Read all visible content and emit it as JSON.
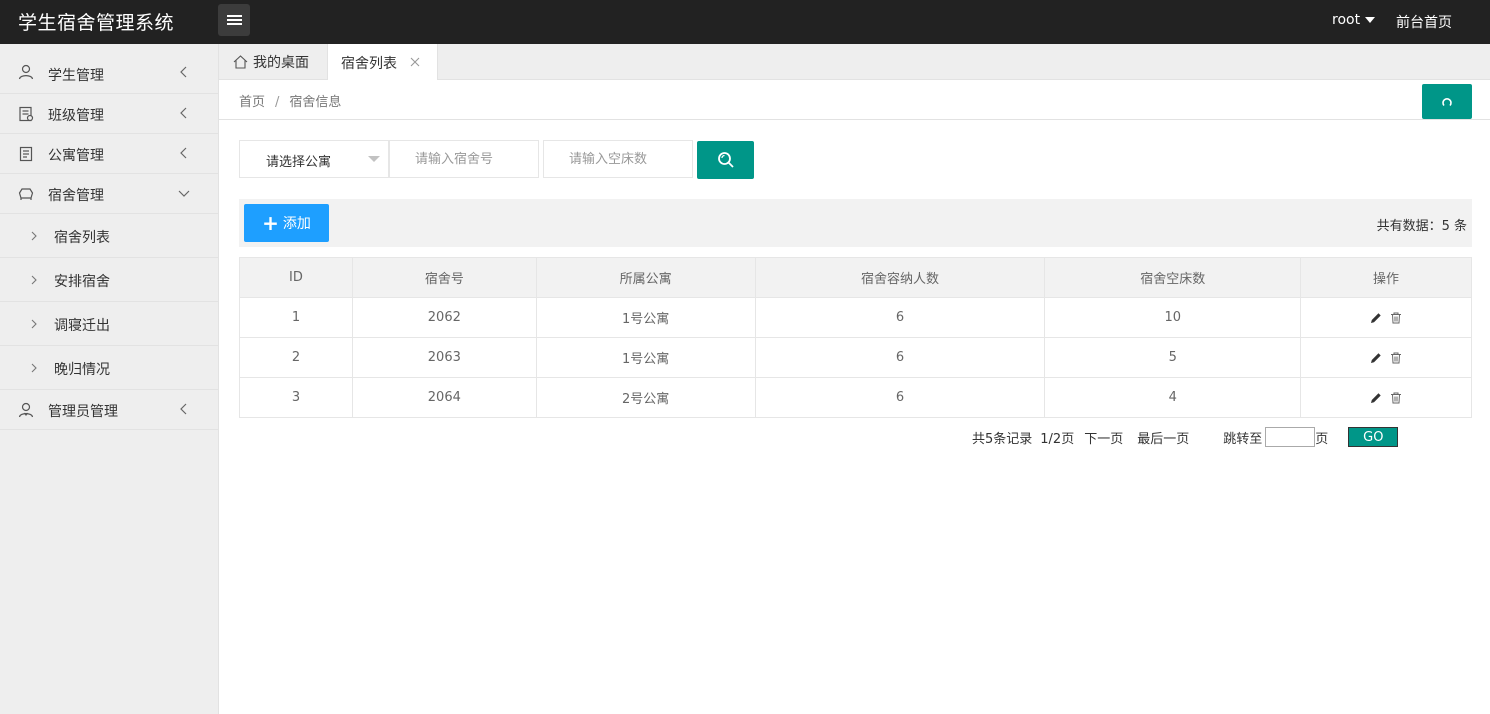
{
  "header": {
    "logo": "学生宿舍管理系统",
    "user": "root",
    "front_page": "前台首页"
  },
  "sidebar": {
    "items": [
      {
        "label": "学生管理",
        "icon": "user-icon"
      },
      {
        "label": "班级管理",
        "icon": "class-icon"
      },
      {
        "label": "公寓管理",
        "icon": "apartment-icon"
      },
      {
        "label": "宿舍管理",
        "icon": "dorm-icon",
        "expanded": true
      },
      {
        "label": "管理员管理",
        "icon": "admin-icon"
      }
    ],
    "subitems": [
      {
        "label": "宿舍列表"
      },
      {
        "label": "安排宿舍"
      },
      {
        "label": "调寝迁出"
      },
      {
        "label": "晚归情况"
      }
    ]
  },
  "tabs": {
    "home": "我的桌面",
    "active": "宿舍列表"
  },
  "breadcrumb": {
    "home": "首页",
    "sep": "/",
    "current": "宿舍信息"
  },
  "search": {
    "select_placeholder": "请选择公寓",
    "dorm_no_placeholder": "请输入宿舍号",
    "empty_beds_placeholder": "请输入空床数"
  },
  "toolbar": {
    "add_label": "添加",
    "total_label": "共有数据：5 条"
  },
  "table": {
    "headers": [
      "ID",
      "宿舍号",
      "所属公寓",
      "宿舍容纳人数",
      "宿舍空床数",
      "操作"
    ],
    "rows": [
      [
        "1",
        "2062",
        "1号公寓",
        "6",
        "10"
      ],
      [
        "2",
        "2063",
        "1号公寓",
        "6",
        "5"
      ],
      [
        "3",
        "2064",
        "2号公寓",
        "6",
        "4"
      ]
    ]
  },
  "pagination": {
    "records": "共5条记录",
    "pages": "1/2页",
    "next": "下一页",
    "last": "最后一页",
    "jump_to": "跳转至",
    "page_unit": "页",
    "go": "GO"
  },
  "colors": {
    "header_bg": "#222222",
    "primary_green": "#009688",
    "add_blue": "#1E9FFF",
    "sidebar_bg": "#EEEEEE"
  }
}
